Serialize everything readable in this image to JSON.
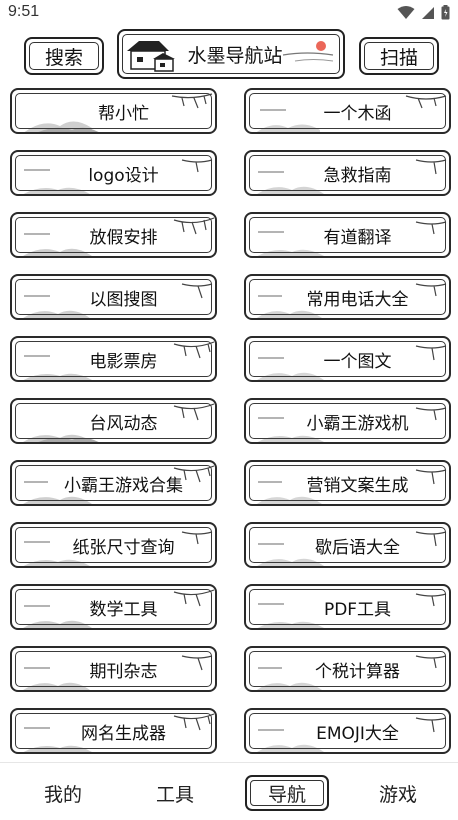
{
  "status": {
    "time": "9:51"
  },
  "header": {
    "search_label": "搜索",
    "title": "水墨导航站",
    "scan_label": "扫描"
  },
  "cards": [
    "帮小忙",
    "一个木函",
    "logo设计",
    "急救指南",
    "放假安排",
    "有道翻译",
    "以图搜图",
    "常用电话大全",
    "电影票房",
    "一个图文",
    "台风动态",
    "小霸王游戏机",
    "小霸王游戏合集",
    "营销文案生成",
    "纸张尺寸查询",
    "歇后语大全",
    "数学工具",
    "PDF工具",
    "期刊杂志",
    "个税计算器",
    "网名生成器",
    "EMOJI大全"
  ],
  "nav": {
    "items": [
      "我的",
      "工具",
      "导航",
      "游戏"
    ],
    "active": "导航"
  },
  "colors": {
    "ink": "#222222",
    "accent_sun": "#e74c3c"
  }
}
